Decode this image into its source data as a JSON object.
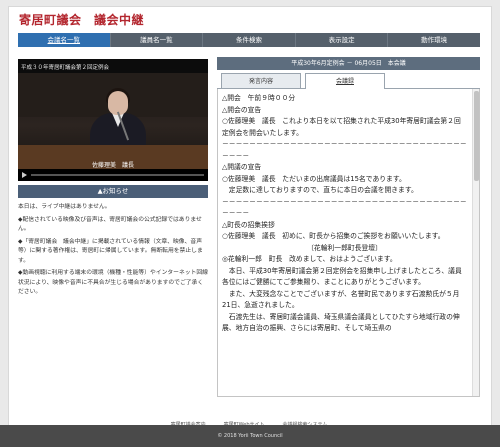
{
  "site_title": "寄居町議会　議会中継",
  "nav": [
    {
      "label": "会議名一覧"
    },
    {
      "label": "議員名一覧"
    },
    {
      "label": "条件検索"
    },
    {
      "label": "表示設定"
    },
    {
      "label": "動作環境"
    }
  ],
  "video": {
    "caption": "平成３０年寄居町議会第２回定例会",
    "speaker_label": "佐藤理美　議長"
  },
  "notice": {
    "button_label": "▲お知らせ",
    "paragraphs": [
      "本日は、ライブ中継はありません。",
      "◆配信されている映像及び音声は、寄居町議会の公式記録ではありません。",
      "◆「寄居町議会　議会中継」に掲載されている情報（文章、映像、音声等）に関する著作権は、寄居町に帰属しています。無断転用を禁止します。",
      "◆動画視聴に利用する端末の環境（機種・性能等）やインターネット回線状況により、映像や音声に不具合が生じる場合がありますのでご了承ください。"
    ]
  },
  "meeting_header": "平成30年6月定例会 － 06月05日　本会議",
  "tabs": [
    {
      "label": "発言内容"
    },
    {
      "label": "会議録"
    }
  ],
  "transcript": [
    "△開会　午前９時００分",
    "△開会の宣告",
    "○佐藤理美　議長　これより本日を以て招集された平成30年寄居町議会第２回定例会を開会いたします。",
    "－－－－－－－－－－－－－－－－－－－－－－－－－－－－－－－－－－－－－－－－",
    "△開議の宣告",
    "○佐藤理美　議長　ただいまの出席議員は15名であります。",
    "　定足数に達しておりますので、直ちに本日の会議を開きます。",
    "－－－－－－－－－－－－－－－－－－－－－－－－－－－－－－－－－－－－－－－－",
    "△町長の招集挨拶",
    "○佐藤理美　議長　初めに、町長から招集のご挨拶をお願いいたします。",
    "〔花輪利一郎町長登壇〕",
    "◎花輪利一郎　町長　改めまして、おはようございます。",
    "　本日、平成30年寄居町議会第２回定例会を招集申し上げましたところ、議員各位にはご健勝にてご参集賜り、まことにありがとうございます。",
    "　また、大変残念なことでございますが、名誉町民であります石渡勲氏が５月21日、急逝されました。",
    "　石渡先生は、寄居町議会議員、埼玉県議会議員としてひたすら地域行政の伸展、地方自治の振興、さらには寄居町、そして埼玉県の"
  ],
  "footer_links": [
    {
      "label": "寄居町議会案内"
    },
    {
      "label": "寄居町Webサイト"
    },
    {
      "label": "会議録検索システム"
    }
  ],
  "copyright": "© 2018 Yorii Town Council"
}
